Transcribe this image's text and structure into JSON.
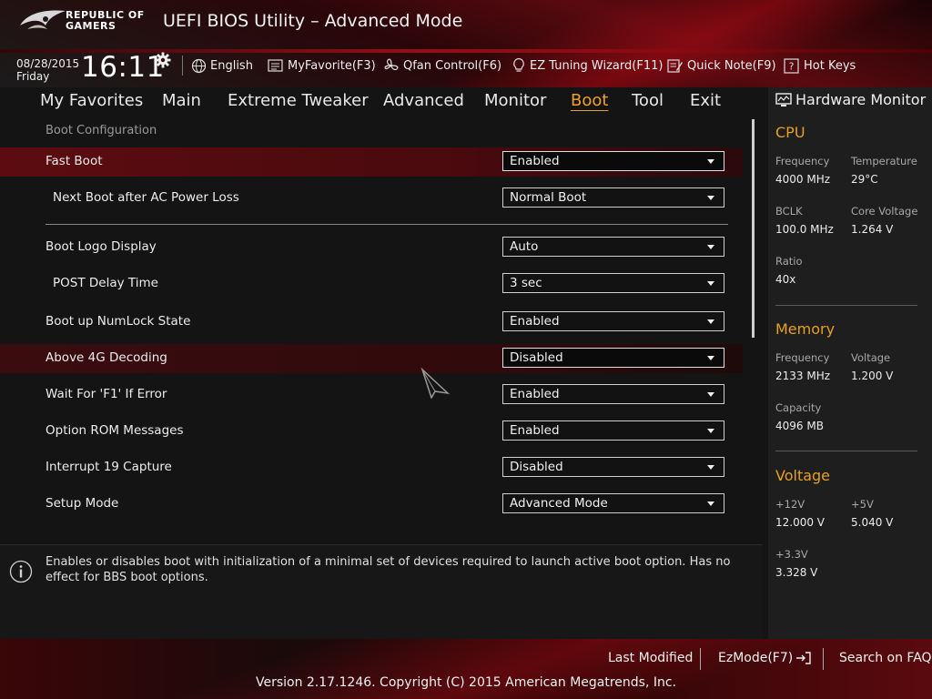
{
  "header": {
    "brand_line1": "REPUBLIC OF",
    "brand_line2": "GAMERS",
    "title": "UEFI BIOS Utility – Advanced Mode",
    "date": "08/28/2015",
    "day": "Friday",
    "time": "16:11",
    "toolbar": {
      "language": "English",
      "my_favorite": "MyFavorite(F3)",
      "qfan": "Qfan Control(F6)",
      "ez_tuning": "EZ Tuning Wizard(F11)",
      "quick_note": "Quick Note(F9)",
      "hot_keys": "Hot Keys"
    }
  },
  "nav": {
    "tabs": [
      "My Favorites",
      "Main",
      "Extreme Tweaker",
      "Advanced",
      "Monitor",
      "Boot",
      "Tool",
      "Exit"
    ],
    "active": "Boot"
  },
  "main": {
    "section_title": "Boot Configuration",
    "rows": [
      {
        "label": "Fast Boot",
        "value": "Enabled"
      },
      {
        "label": "Next Boot after AC Power Loss",
        "value": "Normal Boot"
      },
      {
        "label": "Boot Logo Display",
        "value": "Auto"
      },
      {
        "label": "POST Delay Time",
        "value": "3 sec"
      },
      {
        "label": "Boot up NumLock State",
        "value": "Enabled"
      },
      {
        "label": "Above 4G Decoding",
        "value": "Disabled"
      },
      {
        "label": "Wait For 'F1' If Error",
        "value": "Enabled"
      },
      {
        "label": "Option ROM Messages",
        "value": "Enabled"
      },
      {
        "label": "Interrupt 19 Capture",
        "value": "Disabled"
      },
      {
        "label": "Setup Mode",
        "value": "Advanced Mode"
      }
    ],
    "help_text": "Enables or disables boot with initialization of a minimal set of devices required to launch active boot option. Has no effect for BBS boot options."
  },
  "hardware_monitor": {
    "title": "Hardware Monitor",
    "cpu": {
      "heading": "CPU",
      "frequency_label": "Frequency",
      "frequency": "4000 MHz",
      "temperature_label": "Temperature",
      "temperature": "29°C",
      "bclk_label": "BCLK",
      "bclk": "100.0 MHz",
      "core_voltage_label": "Core Voltage",
      "core_voltage": "1.264 V",
      "ratio_label": "Ratio",
      "ratio": "40x"
    },
    "memory": {
      "heading": "Memory",
      "frequency_label": "Frequency",
      "frequency": "2133 MHz",
      "voltage_label": "Voltage",
      "voltage": "1.200 V",
      "capacity_label": "Capacity",
      "capacity": "4096 MB"
    },
    "voltage": {
      "heading": "Voltage",
      "v12_label": "+12V",
      "v12": "12.000 V",
      "v5_label": "+5V",
      "v5": "5.040 V",
      "v33_label": "+3.3V",
      "v33": "3.328 V"
    }
  },
  "footer": {
    "last_modified": "Last Modified",
    "ez_mode": "EzMode(F7)",
    "search_faq": "Search on FAQ",
    "copyright": "Version 2.17.1246. Copyright (C) 2015 American Megatrends, Inc."
  },
  "colors": {
    "accent": "#f0a020",
    "brand_red": "#c0141e",
    "highlight_row": "#5c0c10"
  }
}
